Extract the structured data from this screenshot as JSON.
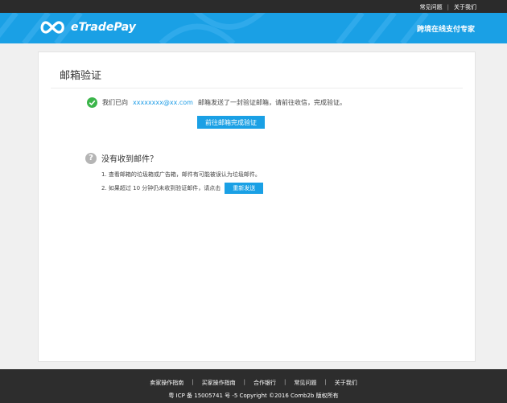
{
  "topbar": {
    "links": [
      "常见问题",
      "关于我们"
    ],
    "separator": "|"
  },
  "header": {
    "brand": "eTradePay",
    "slogan": "跨境在线支付专家"
  },
  "main": {
    "title": "邮箱验证",
    "verify": {
      "prefix": "我们已向",
      "email": "xxxxxxxx@xx.com",
      "suffix": "邮箱发送了一封验证邮箱，请前往收信，完成验证。",
      "button": "前往邮箱完成验证"
    },
    "no_mail": {
      "question": "没有收到邮件？",
      "tip1": "1. 查看邮箱的垃圾箱或广告箱，邮件有可能被误认为垃圾邮件。",
      "tip2": "2. 如果超过 10 分钟仍未收到验证邮件，请点击",
      "resend_button": "重新发送"
    }
  },
  "footer": {
    "links": [
      "卖家操作指南",
      "买家操作指南",
      "合作银行",
      "常见问题",
      "关于我们"
    ],
    "separator": "|",
    "copyright": "粤 ICP 备 15005741 号 -5 Copyright ©2016 Comb2b 版权所有"
  },
  "colors": {
    "accent": "#1aa0e5",
    "success": "#3bb54a",
    "dark_bar": "#2b2b2b"
  }
}
